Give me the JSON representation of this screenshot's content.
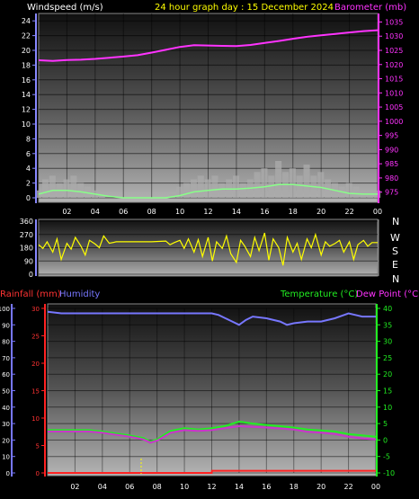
{
  "header": {
    "wind_label": "Windspeed (m/s)",
    "title": "24 hour graph day : 15 December 2024",
    "baro_label": "Barometer (mb)"
  },
  "compass": [
    "N",
    "W",
    "S",
    "E",
    "N"
  ],
  "bottom_header": {
    "rain_label": "Rainfall (mm)",
    "hum_label": "Humidity",
    "temp_label": "Temperature (°C)",
    "dew_label": "Dew Point (°C)"
  },
  "colors": {
    "wind": "#ffffff",
    "gust_fill": "#aaaaaa",
    "wind_avg": "#88ff88",
    "baro": "#ff33ff",
    "dir": "#ffff00",
    "rain": "#ff2222",
    "humidity": "#7777ff",
    "temp": "#22ee22",
    "dew": "#cc33cc",
    "title": "#ffff00"
  },
  "chart_data": [
    {
      "type": "line",
      "name": "wind-baro",
      "x_ticks": [
        "02",
        "04",
        "06",
        "08",
        "10",
        "12",
        "14",
        "16",
        "18",
        "20",
        "22",
        "00"
      ],
      "y_left_ticks": [
        "0",
        "2",
        "4",
        "6",
        "8",
        "10",
        "12",
        "14",
        "16",
        "18",
        "20",
        "22",
        "24"
      ],
      "y_right_ticks": [
        "975",
        "980",
        "985",
        "990",
        "995",
        "1000",
        "1005",
        "1010",
        "1015",
        "1020",
        "1025",
        "1030",
        "1035"
      ],
      "ylim_left": [
        0,
        25
      ],
      "ylim_right": [
        973,
        1038
      ],
      "xlim": [
        0,
        24
      ],
      "series": [
        {
          "role": "gust",
          "x": [
            0,
            0.5,
            1,
            1.5,
            2,
            2.5,
            3,
            3.5,
            4,
            4.5,
            5,
            5.5,
            6,
            6.5,
            7,
            7.5,
            8,
            8.5,
            9,
            9.5,
            10,
            10.5,
            11,
            11.5,
            12,
            12.5,
            13,
            13.5,
            14,
            14.5,
            15,
            15.5,
            16,
            16.5,
            17,
            17.5,
            18,
            18.5,
            19,
            19.5,
            20,
            20.5,
            21,
            21.5,
            22,
            22.5,
            23,
            23.5,
            24
          ],
          "values": [
            1,
            2.5,
            3,
            2,
            2.5,
            3,
            2,
            1.5,
            1,
            0.5,
            0,
            0,
            0,
            0,
            0,
            0,
            0,
            0,
            0,
            0.5,
            1.5,
            2,
            2.5,
            3,
            2.5,
            3,
            2,
            2.5,
            3,
            2,
            2.5,
            3.5,
            4,
            3,
            5,
            3.5,
            4,
            3,
            4.5,
            3,
            3.5,
            2.5,
            2,
            1.5,
            2,
            1.5,
            1,
            1,
            1
          ]
        },
        {
          "role": "avg",
          "x": [
            0,
            1,
            2,
            3,
            4,
            5,
            6,
            7,
            8,
            9,
            10,
            11,
            12,
            13,
            14,
            15,
            16,
            17,
            18,
            19,
            20,
            21,
            22,
            23,
            24
          ],
          "values": [
            0.5,
            1,
            1,
            0.8,
            0.5,
            0.2,
            0,
            0,
            0,
            0,
            0.3,
            0.8,
            1,
            1.2,
            1.2,
            1.3,
            1.5,
            1.8,
            1.8,
            1.6,
            1.4,
            1.0,
            0.6,
            0.5,
            0.5
          ]
        },
        {
          "role": "barometer",
          "x": [
            0,
            1,
            2,
            3,
            4,
            5,
            6,
            7,
            8,
            9,
            10,
            11,
            12,
            13,
            14,
            15,
            16,
            17,
            18,
            19,
            20,
            21,
            22,
            23,
            24
          ],
          "values": [
            1021.5,
            1021.3,
            1021.6,
            1021.7,
            1022,
            1022.4,
            1022.8,
            1023.3,
            1024.2,
            1025.2,
            1026.2,
            1026.8,
            1026.7,
            1026.6,
            1026.5,
            1026.9,
            1027.6,
            1028.3,
            1029.1,
            1029.8,
            1030.3,
            1030.8,
            1031.3,
            1031.8,
            1032.1
          ]
        }
      ]
    },
    {
      "type": "scatter",
      "name": "wind-direction",
      "y_ticks": [
        "360",
        "270",
        "180",
        "90",
        "0"
      ],
      "ylim": [
        0,
        360
      ],
      "xlim": [
        0,
        24
      ],
      "series": [
        {
          "role": "direction",
          "x": [
            0,
            0.3,
            0.6,
            1,
            1.3,
            1.6,
            2,
            2.3,
            2.6,
            3,
            3.3,
            3.6,
            4,
            4.3,
            4.6,
            5,
            5.5,
            6,
            7,
            8,
            9,
            9.3,
            9.6,
            10,
            10.3,
            10.6,
            11,
            11.3,
            11.6,
            12,
            12.3,
            12.6,
            13,
            13.3,
            13.6,
            14,
            14.3,
            14.6,
            15,
            15.3,
            15.6,
            16,
            16.3,
            16.6,
            17,
            17.3,
            17.6,
            18,
            18.3,
            18.6,
            19,
            19.3,
            19.6,
            20,
            20.3,
            20.6,
            21,
            21.3,
            21.6,
            22,
            22.3,
            22.6,
            23,
            23.3,
            23.6,
            24
          ],
          "values": [
            200,
            175,
            220,
            150,
            240,
            100,
            210,
            170,
            250,
            190,
            130,
            230,
            205,
            180,
            260,
            210,
            220,
            220,
            220,
            220,
            225,
            200,
            215,
            230,
            175,
            240,
            150,
            235,
            120,
            250,
            90,
            220,
            175,
            260,
            140,
            80,
            230,
            190,
            120,
            250,
            160,
            280,
            95,
            240,
            180,
            60,
            250,
            150,
            210,
            100,
            240,
            180,
            270,
            130,
            220,
            190,
            210,
            230,
            150,
            220,
            100,
            200,
            230,
            190,
            215,
            215
          ]
        }
      ]
    },
    {
      "type": "line",
      "name": "rain-humidity-temp",
      "x_ticks": [
        "02",
        "04",
        "06",
        "08",
        "10",
        "12",
        "14",
        "16",
        "18",
        "20",
        "22",
        "00"
      ],
      "y_left_hum_ticks": [
        "100",
        "90",
        "80",
        "70",
        "60",
        "50",
        "40",
        "30",
        "20",
        "10",
        "0"
      ],
      "y_left_rain_ticks": [
        "30",
        "25",
        "20",
        "15",
        "10",
        "5",
        "0"
      ],
      "y_right_ticks": [
        "40",
        "35",
        "30",
        "25",
        "20",
        "15",
        "10",
        "5",
        "0",
        "-5",
        "-10"
      ],
      "ylim_humidity": [
        0,
        100
      ],
      "ylim_temp": [
        -10,
        40
      ],
      "xlim": [
        0,
        24
      ],
      "series": [
        {
          "role": "humidity",
          "x": [
            0,
            1,
            2,
            3,
            4,
            5,
            6,
            7,
            8,
            9,
            10,
            11,
            12,
            12.5,
            13,
            13.5,
            14,
            14.5,
            15,
            16,
            17,
            17.5,
            18,
            19,
            20,
            21,
            22,
            22.5,
            23,
            24
          ],
          "values": [
            98,
            97,
            97,
            97,
            97,
            97,
            97,
            97,
            97,
            97,
            97,
            97,
            97,
            96,
            94,
            92,
            90,
            93,
            95,
            94,
            92,
            90,
            91,
            92,
            92,
            94,
            97,
            96,
            95,
            95
          ]
        },
        {
          "role": "temperature",
          "x": [
            0,
            1,
            2,
            3,
            4,
            5,
            6,
            7,
            7.5,
            8,
            8.5,
            9,
            10,
            11,
            12,
            13,
            14,
            15,
            16,
            17,
            18,
            19,
            20,
            21,
            22,
            23,
            24
          ],
          "values": [
            3,
            3,
            3,
            3,
            2.6,
            2,
            1.4,
            0.6,
            -0.5,
            0.2,
            1.5,
            2.8,
            3.6,
            3.2,
            3.6,
            4.3,
            5.6,
            5.0,
            4.6,
            4.2,
            3.8,
            3.2,
            2.9,
            2.6,
            1.8,
            1.4,
            1.0
          ]
        },
        {
          "role": "dewpoint",
          "x": [
            0,
            1,
            2,
            3,
            4,
            5,
            6,
            7,
            7.5,
            8,
            8.5,
            9,
            10,
            11,
            12,
            13,
            14,
            15,
            16,
            17,
            18,
            19,
            20,
            21,
            22,
            23,
            24
          ],
          "values": [
            2.6,
            2.6,
            2.6,
            2.6,
            2.2,
            1.6,
            1.0,
            0.2,
            -0.8,
            -0.2,
            1.0,
            2.2,
            3.0,
            2.8,
            3.0,
            3.6,
            4.2,
            4.0,
            3.8,
            3.5,
            3.2,
            2.5,
            2.2,
            1.8,
            1.0,
            0.5,
            0.2
          ]
        },
        {
          "role": "rainfall",
          "x": [
            0,
            12,
            12.01,
            24
          ],
          "values": [
            0,
            0,
            0.4,
            0.4
          ]
        }
      ]
    }
  ]
}
